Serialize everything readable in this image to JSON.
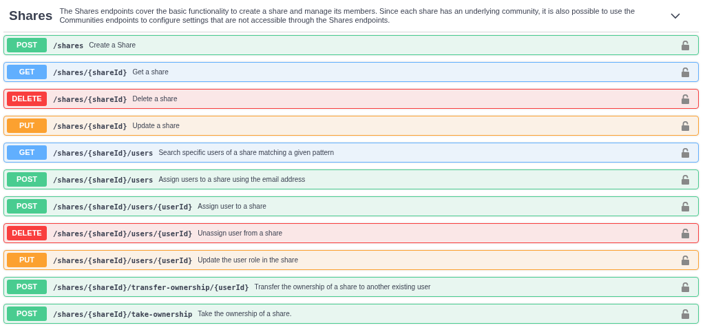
{
  "section": {
    "title": "Shares",
    "description": "The Shares endpoints cover the basic functionality to create a share and manage its members. Since each share has an underlying community, it is also possible to use the Communities endpoints to configure settings that are not accessible through the Shares endpoints.",
    "expanded": true
  },
  "operations": [
    {
      "method": "POST",
      "path": "/shares",
      "summary": "Create a Share"
    },
    {
      "method": "GET",
      "path": "/shares/{shareId}",
      "summary": "Get a share"
    },
    {
      "method": "DELETE",
      "path": "/shares/{shareId}",
      "summary": "Delete a share"
    },
    {
      "method": "PUT",
      "path": "/shares/{shareId}",
      "summary": "Update a share"
    },
    {
      "method": "GET",
      "path": "/shares/{shareId}/users",
      "summary": "Search specific users of a share matching a given pattern"
    },
    {
      "method": "POST",
      "path": "/shares/{shareId}/users",
      "summary": "Assign users to a share using the email address"
    },
    {
      "method": "POST",
      "path": "/shares/{shareId}/users/{userId}",
      "summary": "Assign user to a share"
    },
    {
      "method": "DELETE",
      "path": "/shares/{shareId}/users/{userId}",
      "summary": "Unassign user from a share"
    },
    {
      "method": "PUT",
      "path": "/shares/{shareId}/users/{userId}",
      "summary": "Update the user role in the share"
    },
    {
      "method": "POST",
      "path": "/shares/{shareId}/transfer-ownership/{userId}",
      "summary": "Transfer the ownership of a share to another existing user"
    },
    {
      "method": "POST",
      "path": "/shares/{shareId}/take-ownership",
      "summary": "Take the ownership of a share."
    }
  ]
}
